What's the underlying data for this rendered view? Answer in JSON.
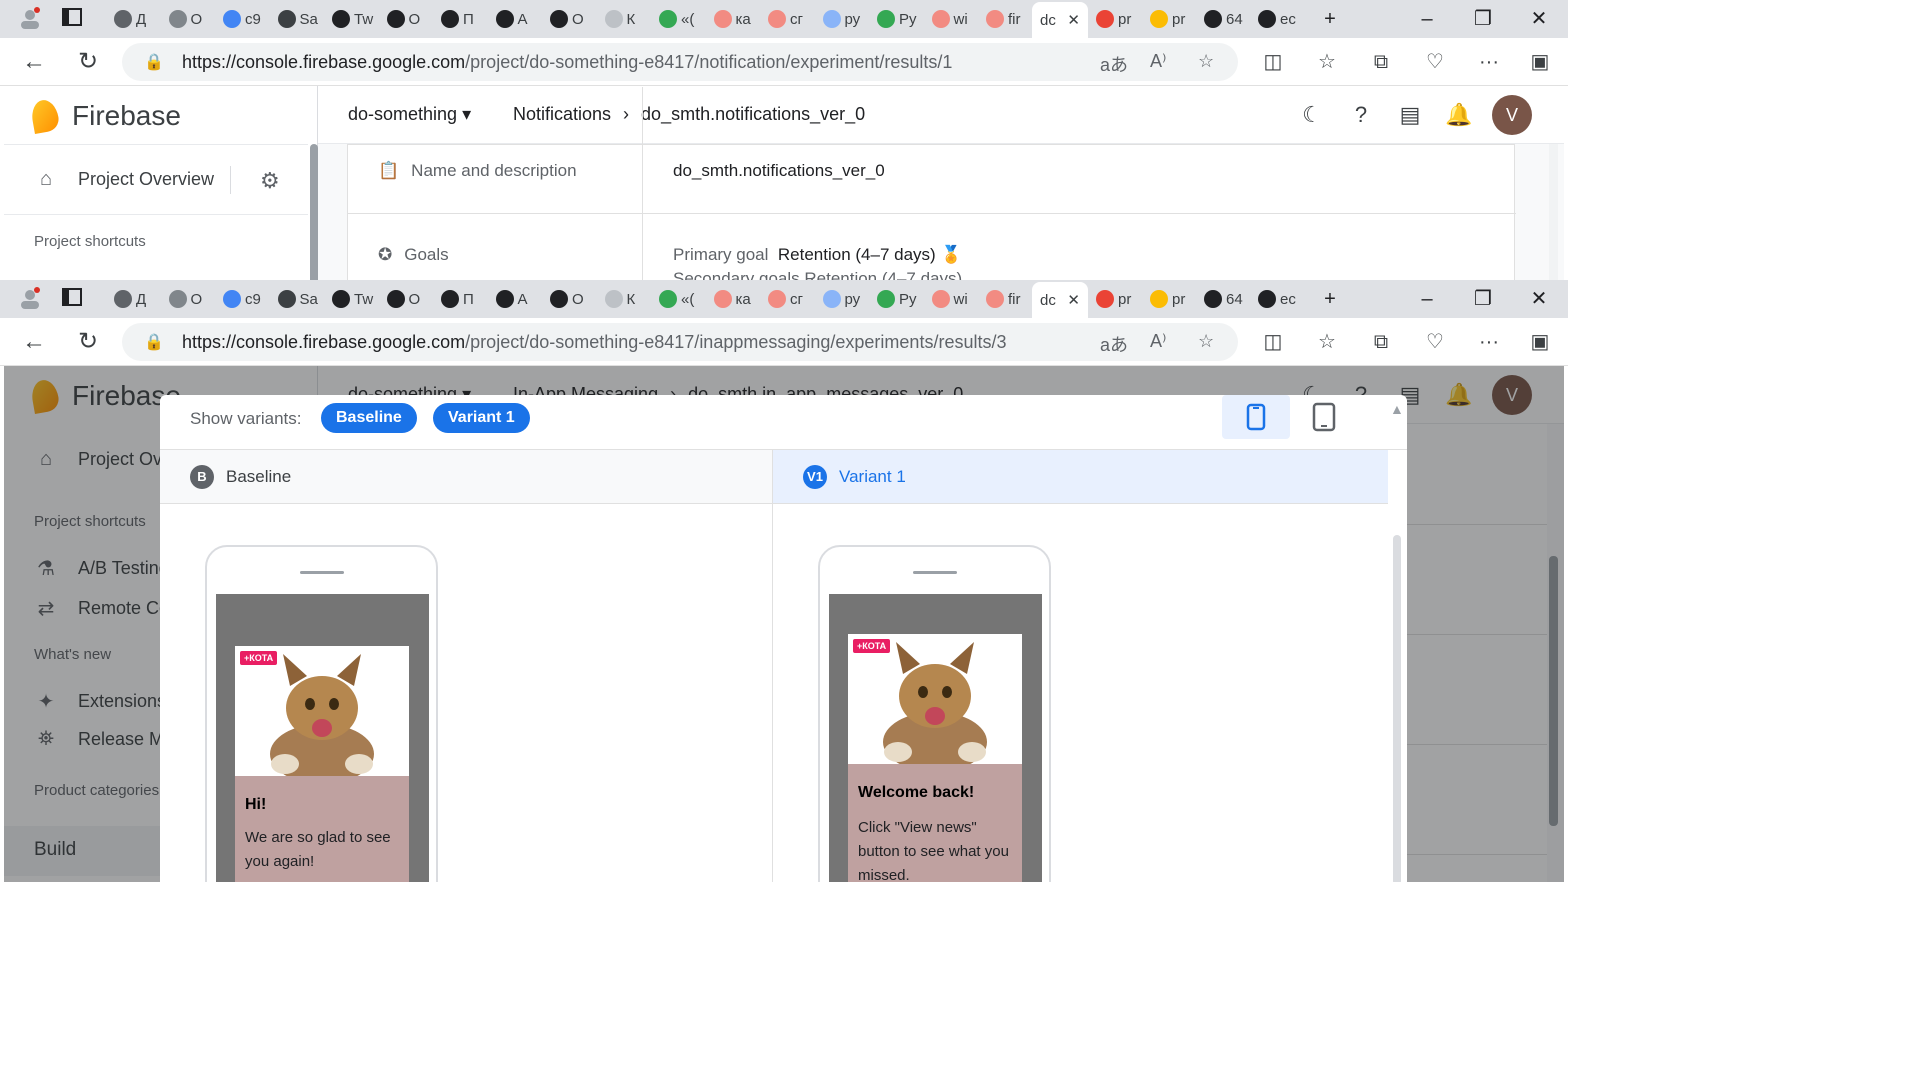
{
  "tabs": [
    {
      "label": "Д"
    },
    {
      "label": "О"
    },
    {
      "label": "c9"
    },
    {
      "label": "Sa"
    },
    {
      "label": "Tw"
    },
    {
      "label": "О"
    },
    {
      "label": "П"
    },
    {
      "label": "А"
    },
    {
      "label": "О"
    },
    {
      "label": "К"
    },
    {
      "label": "«("
    },
    {
      "label": "ка"
    },
    {
      "label": "сг"
    },
    {
      "label": "ру"
    },
    {
      "label": "Ру"
    },
    {
      "label": "wi"
    },
    {
      "label": "fir"
    }
  ],
  "active_tab": {
    "label": "dc"
  },
  "right_tabs": [
    {
      "label": "pr"
    },
    {
      "label": "pr"
    },
    {
      "label": "64"
    },
    {
      "label": "ec"
    }
  ],
  "window_top": {
    "url_host": "https://console.firebase.google.com",
    "url_path": "/project/do-something-e8417/notification/experiment/results/1",
    "project": "do-something",
    "breadcrumb_section": "Notifications",
    "breadcrumb_item": "do_smth.notifications_ver_0",
    "rows": [
      {
        "label": "Name and description",
        "value": "do_smth.notifications_ver_0"
      },
      {
        "label": "Goals",
        "value_prefix": "Primary goal",
        "value": "Retention (4–7 days)",
        "sub": "Secondary goals  Retention (4–7 days)"
      }
    ]
  },
  "window_bottom": {
    "url_host": "https://console.firebase.google.com",
    "url_path": "/project/do-something-e8417/inappmessaging/experiments/results/3",
    "project": "do-something",
    "breadcrumb_section": "In-App Messaging",
    "breadcrumb_item": "do_smth.in_app_messages_ver_0"
  },
  "app": {
    "logo": "Firebase",
    "project_overview": "Project Overview",
    "project_shortcuts": "Project shortcuts",
    "shortcuts": [
      "A/B Testing",
      "Remote Config"
    ],
    "whats_new": "What's new",
    "new_items": [
      "Extensions",
      "Release Monitoring"
    ],
    "product_categories": "Product categories",
    "build": "Build",
    "avatar_letter": "V"
  },
  "modal": {
    "show_variants": "Show variants:",
    "chips": [
      "Baseline",
      "Variant 1"
    ],
    "baseline": {
      "badge": "B",
      "title": "Baseline",
      "tag": "+КОТА",
      "heading": "Hi!",
      "body": "We are so glad to see you again!"
    },
    "variant": {
      "badge": "V1",
      "title": "Variant 1",
      "tag": "+КОТА",
      "heading": "Welcome back!",
      "body": "Click \"View news\" button to see what you missed."
    }
  },
  "colors": {
    "accent": "#1a73e8",
    "message_bg": "#bfa1a0",
    "screen_bg": "#757575"
  }
}
